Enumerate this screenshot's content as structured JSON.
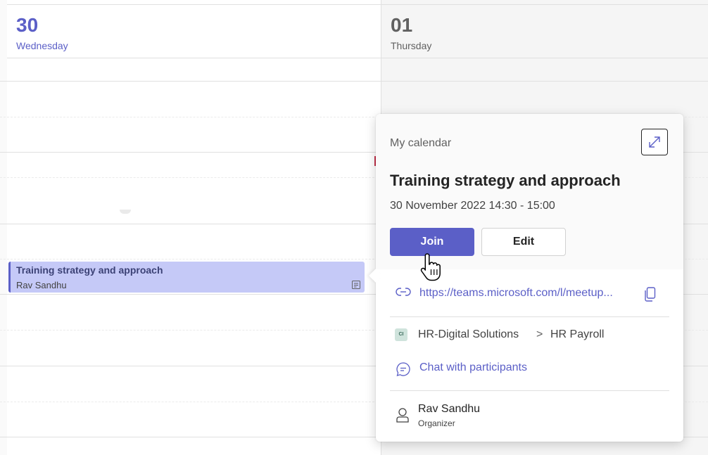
{
  "calendar": {
    "days": [
      {
        "number": "30",
        "name": "Wednesday",
        "selected": true
      },
      {
        "number": "01",
        "name": "Thursday",
        "selected": false
      }
    ],
    "event": {
      "title": "Training strategy and approach",
      "organizer": "Rav Sandhu",
      "icon": "notes-icon"
    }
  },
  "popup": {
    "calendar_label": "My calendar",
    "expand_icon": "expand-icon",
    "title": "Training strategy and approach",
    "datetime": "30 November 2022 14:30 - 15:00",
    "join_label": "Join",
    "edit_label": "Edit",
    "meeting_link": "https://teams.microsoft.com/l/meetup...",
    "team_avatar": "CI",
    "team_name": "HR-Digital Solutions",
    "team_separator": ">",
    "channel_name": "HR Payroll",
    "chat_label": "Chat with participants",
    "organizer_name": "Rav Sandhu",
    "organizer_role": "Organizer"
  },
  "colors": {
    "accent": "#5b5fc7",
    "event_bg": "#c5c9f7"
  }
}
